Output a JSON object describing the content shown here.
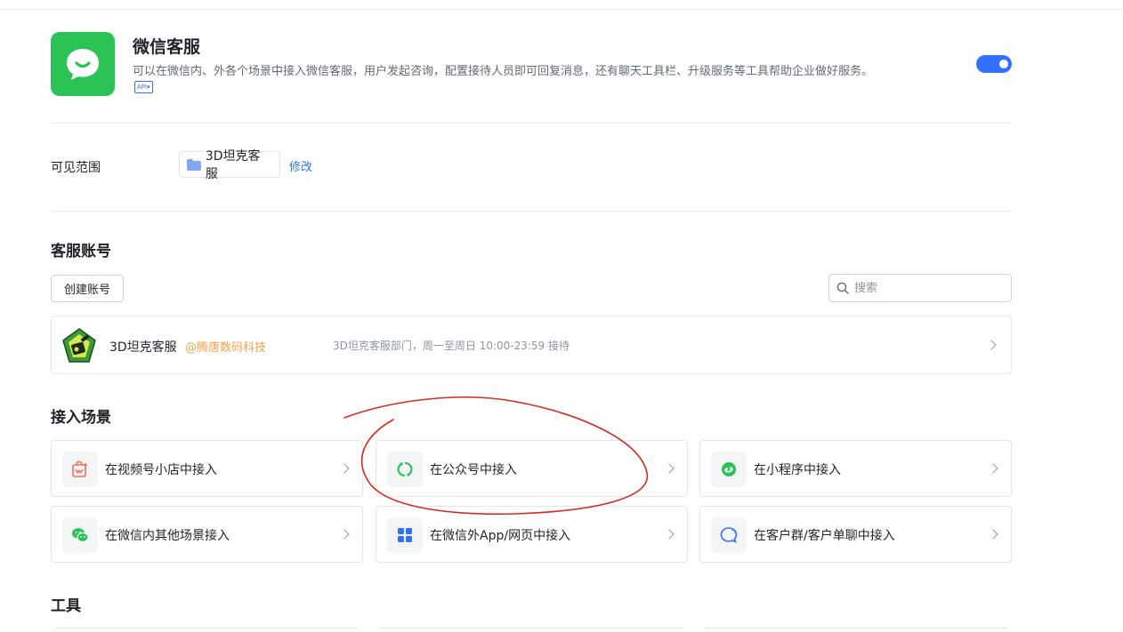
{
  "app": {
    "title": "微信客服",
    "description": "可以在微信内、外各个场景中接入微信客服，用户发起咨询，配置接待人员即可回复消息，还有聊天工具栏、升级服务等工具帮助企业做好服务。",
    "api_badge": "API"
  },
  "scope": {
    "label": "可见范围",
    "chip": "3D坦克客服",
    "edit_link": "修改"
  },
  "accounts": {
    "title": "客服账号",
    "create_button": "创建账号",
    "search_placeholder": "搜索",
    "items": [
      {
        "name": "3D坦克客服",
        "org": "@腾唐数码科技",
        "info": "3D坦克客服部门，周一至周日 10:00-23:59 接待"
      }
    ]
  },
  "scenes": {
    "title": "接入场景",
    "items": [
      {
        "label": "在视频号小店中接入",
        "icon": "shop-icon"
      },
      {
        "label": "在公众号中接入",
        "icon": "official-account-icon"
      },
      {
        "label": "在小程序中接入",
        "icon": "mini-program-icon"
      },
      {
        "label": "在微信内其他场景接入",
        "icon": "wechat-icon"
      },
      {
        "label": "在微信外App/网页中接入",
        "icon": "app-grid-icon"
      },
      {
        "label": "在客户群/客户单聊中接入",
        "icon": "chat-bubble-icon"
      }
    ]
  },
  "tools": {
    "title": "工具"
  },
  "colors": {
    "accent": "#3370ff",
    "brand_green": "#2bc355",
    "org_orange": "#f7a34c",
    "annotation_red": "#d62a1f"
  }
}
